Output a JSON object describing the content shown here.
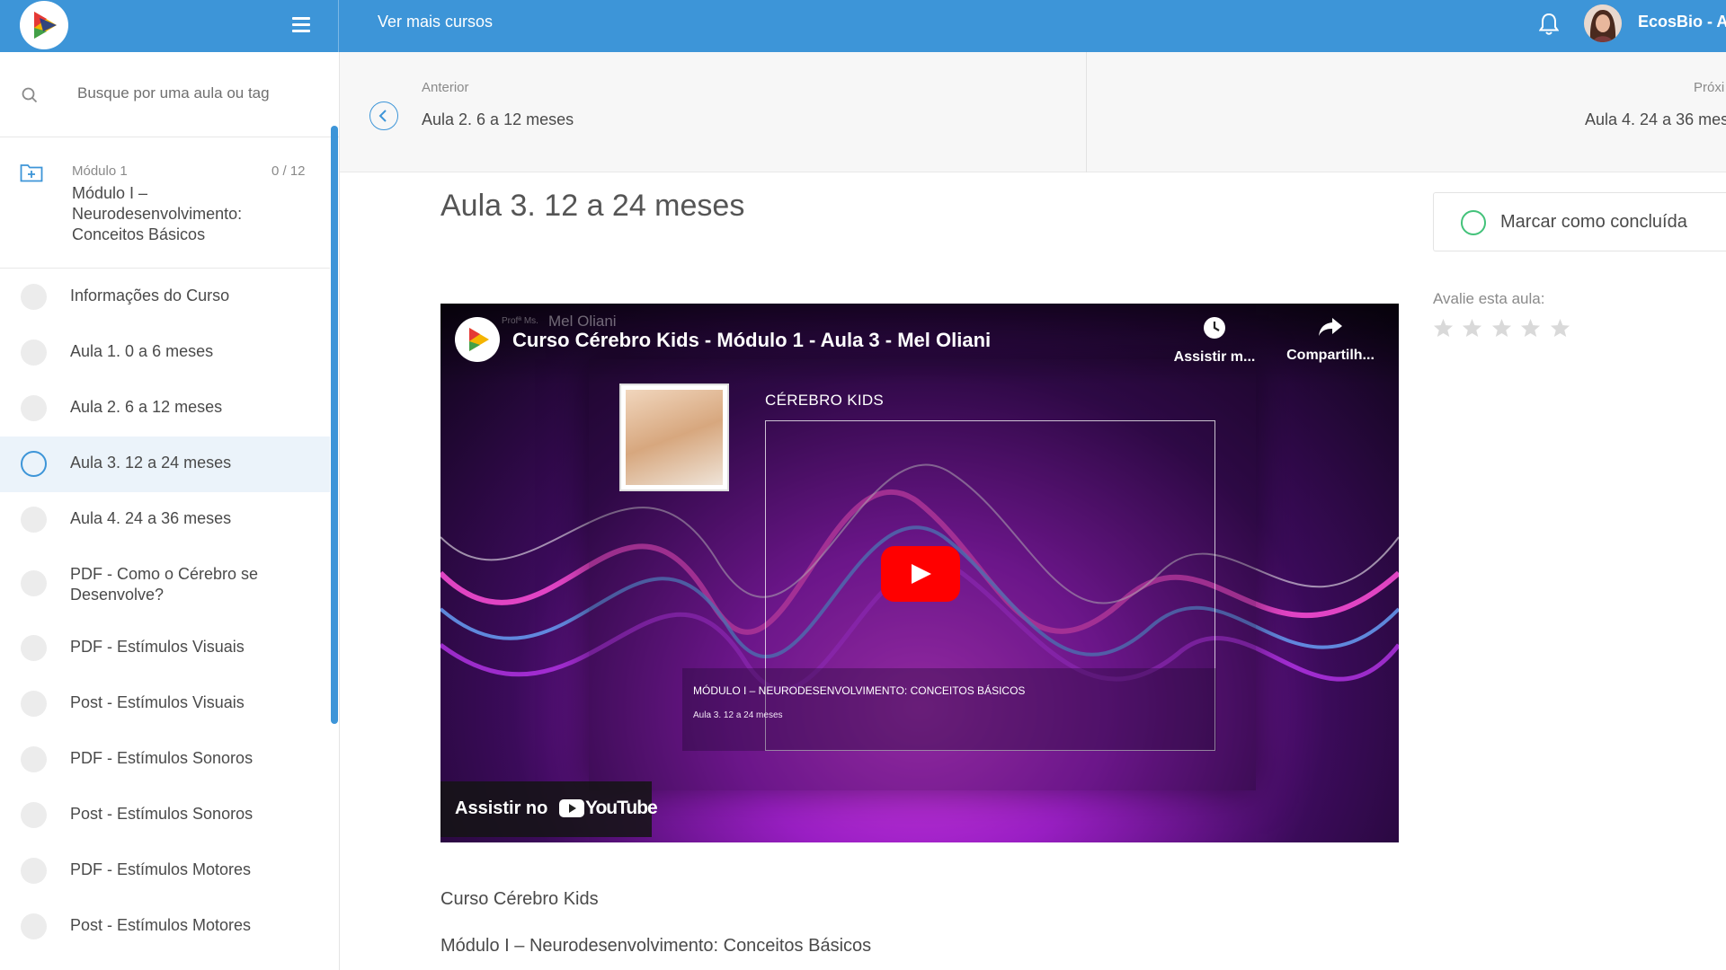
{
  "header": {
    "more_courses": "Ver mais cursos",
    "user_name": "EcosBio - An",
    "colors": {
      "bar": "#3d95d8",
      "accent": "#3d95d8",
      "success": "#43c27a"
    },
    "icons": {
      "menu": "hamburger-icon",
      "bell": "bell-icon",
      "logo": "play-triangle-logo"
    }
  },
  "sidebar": {
    "search_placeholder": "Busque por uma aula ou tag",
    "module": {
      "small_label": "Módulo 1",
      "count": "0 / 12",
      "title": "Módulo I – Neurodesenvolvimento: Conceitos Básicos"
    },
    "lessons": [
      {
        "label": "Informações do Curso",
        "active": false
      },
      {
        "label": "Aula 1. 0 a 6 meses",
        "active": false
      },
      {
        "label": "Aula 2. 6 a 12 meses",
        "active": false
      },
      {
        "label": "Aula 3. 12 a 24 meses",
        "active": true
      },
      {
        "label": "Aula 4. 24 a 36 meses",
        "active": false
      },
      {
        "label": "PDF - Como o Cérebro se Desenvolve?",
        "active": false
      },
      {
        "label": "PDF - Estímulos Visuais",
        "active": false
      },
      {
        "label": "Post - Estímulos Visuais",
        "active": false
      },
      {
        "label": "PDF - Estímulos Sonoros",
        "active": false
      },
      {
        "label": "Post - Estímulos Sonoros",
        "active": false
      },
      {
        "label": "PDF - Estímulos Motores",
        "active": false
      },
      {
        "label": "Post - Estímulos Motores",
        "active": false
      }
    ]
  },
  "nav": {
    "prev_small": "Anterior",
    "prev_title": "Aula 2. 6 a 12 meses",
    "next_small": "Próxi",
    "next_title": "Aula 4. 24 a 36 mes"
  },
  "main": {
    "lesson_title": "Aula 3. 12 a 24 meses",
    "video": {
      "title": "Curso Cérebro Kids - Módulo 1 - Aula 3 - Mel Oliani",
      "channel_faint": "Profª Ms.",
      "channel_name": "Mel Oliani",
      "watch_later": "Assistir m...",
      "share": "Compartilh...",
      "watch_on": "Assistir no",
      "yt_word": "YouTube",
      "card_brand": "CÉREBRO KIDS",
      "card_sub1": "MÓDULO I – NEURODESENVOLVIMENTO: CONCEITOS BÁSICOS",
      "card_sub2": "Aula 3. 12 a 24 meses"
    },
    "desc_line1": "Curso Cérebro Kids",
    "desc_line2": "Módulo I – Neurodesenvolvimento: Conceitos Básicos"
  },
  "right": {
    "complete_label": "Marcar como concluída",
    "rate_label": "Avalie esta aula:",
    "rating": 0,
    "rating_max": 5
  }
}
